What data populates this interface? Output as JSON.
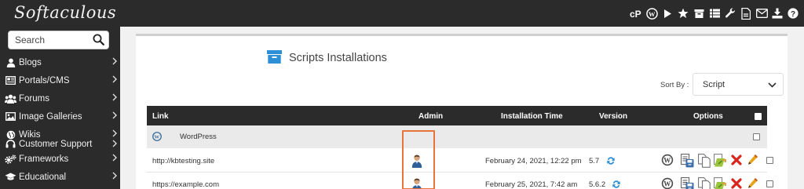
{
  "app": {
    "logo_text": "Softaculous"
  },
  "topbar": {
    "icons": [
      "cpanel-icon",
      "wordpress-icon",
      "play-icon",
      "star-icon",
      "archive-icon",
      "list-icon",
      "wrench-icon",
      "document-icon",
      "mail-icon",
      "download-icon",
      "help-icon"
    ]
  },
  "sidebar": {
    "search_placeholder": "Search",
    "items": [
      {
        "label": "Blogs",
        "icon": "user-icon"
      },
      {
        "label": "Portals/CMS",
        "icon": "newspaper-icon"
      },
      {
        "label": "Forums",
        "icon": "users-icon"
      },
      {
        "label": "Image Galleries",
        "icon": "image-icon"
      },
      {
        "label": "Wikis",
        "icon": "globe-icon"
      },
      {
        "label": "Customer Support",
        "icon": "support-icon"
      },
      {
        "label": "Frameworks",
        "icon": "cogs-icon"
      },
      {
        "label": "Educational",
        "icon": "graduation-cap-icon"
      }
    ]
  },
  "main": {
    "title": "Scripts Installations",
    "sort_label": "Sort By :",
    "sort_value": "Script",
    "table": {
      "headers": {
        "link": "Link",
        "admin": "Admin",
        "time": "Installation Time",
        "version": "Version",
        "options": "Options"
      },
      "group": {
        "name": "WordPress"
      },
      "rows": [
        {
          "link": "http://kbtesting.site",
          "time": "February 24, 2021, 12:22 pm",
          "version": "5.7"
        },
        {
          "link": "https://example.com",
          "time": "February 25, 2021, 7:42 am",
          "version": "5.6.2"
        }
      ]
    }
  },
  "colors": {
    "topbar_bg": "#2b2b2b",
    "accent_blue": "#2d8fd5",
    "highlight_orange": "#e8743b",
    "delete_red": "#d9261c",
    "edit_orange": "#e8a317"
  }
}
